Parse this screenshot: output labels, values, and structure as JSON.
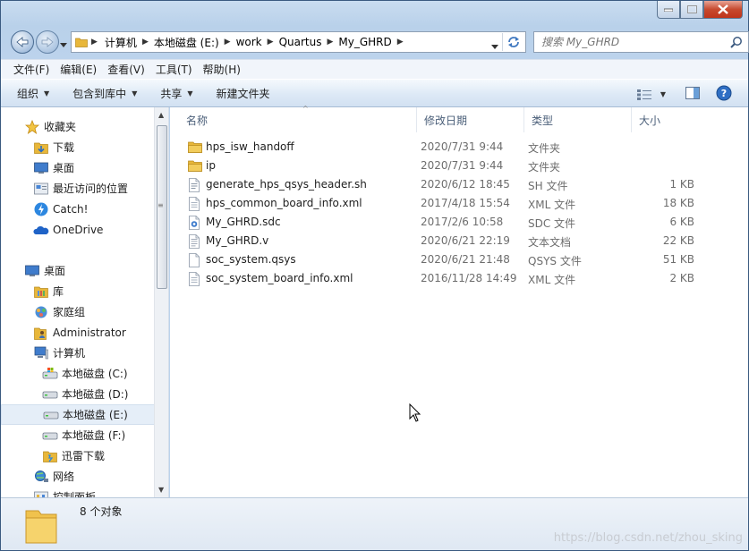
{
  "window": {
    "title_buttons": {
      "minimize": "minimize-button",
      "maximize": "maximize-button",
      "close": "close-button"
    }
  },
  "address": {
    "crumbs": [
      "计算机",
      "本地磁盘 (E:)",
      "work",
      "Quartus",
      "My_GHRD"
    ]
  },
  "search": {
    "placeholder": "搜索 My_GHRD"
  },
  "menubar": {
    "items": [
      "文件(F)",
      "编辑(E)",
      "查看(V)",
      "工具(T)",
      "帮助(H)"
    ]
  },
  "toolbar": {
    "organize": "组织",
    "include_library": "包含到库中",
    "share": "共享",
    "new_folder": "新建文件夹"
  },
  "nav": {
    "items": [
      {
        "label": "收藏夹",
        "icon": "star-icon",
        "indent": 0
      },
      {
        "label": "下载",
        "icon": "download-folder-icon",
        "indent": 1
      },
      {
        "label": "桌面",
        "icon": "desktop-icon",
        "indent": 1
      },
      {
        "label": "最近访问的位置",
        "icon": "recent-places-icon",
        "indent": 1
      },
      {
        "label": "Catch!",
        "icon": "catch-icon",
        "indent": 1
      },
      {
        "label": "OneDrive",
        "icon": "onedrive-icon",
        "indent": 1
      },
      {
        "label": "桌面",
        "icon": "desktop-icon",
        "indent": 0
      },
      {
        "label": "库",
        "icon": "library-icon",
        "indent": 1
      },
      {
        "label": "家庭组",
        "icon": "homegroup-icon",
        "indent": 1
      },
      {
        "label": "Administrator",
        "icon": "user-folder-icon",
        "indent": 1
      },
      {
        "label": "计算机",
        "icon": "computer-icon",
        "indent": 1
      },
      {
        "label": "本地磁盘 (C:)",
        "icon": "drive-c-icon",
        "indent": 2
      },
      {
        "label": "本地磁盘 (D:)",
        "icon": "drive-icon",
        "indent": 2
      },
      {
        "label": "本地磁盘 (E:)",
        "icon": "drive-icon",
        "indent": 2,
        "selected": true
      },
      {
        "label": "本地磁盘 (F:)",
        "icon": "drive-icon",
        "indent": 2
      },
      {
        "label": "迅雷下载",
        "icon": "xunlei-folder-icon",
        "indent": 2
      },
      {
        "label": "网络",
        "icon": "network-icon",
        "indent": 1
      },
      {
        "label": "控制面板",
        "icon": "control-panel-icon",
        "indent": 1
      }
    ]
  },
  "columns": {
    "name": "名称",
    "date": "修改日期",
    "type": "类型",
    "size": "大小"
  },
  "files": [
    {
      "name": "hps_isw_handoff",
      "date": "2020/7/31 9:44",
      "type": "文件夹",
      "size": "",
      "icon": "folder-icon"
    },
    {
      "name": "ip",
      "date": "2020/7/31 9:44",
      "type": "文件夹",
      "size": "",
      "icon": "folder-icon"
    },
    {
      "name": "generate_hps_qsys_header.sh",
      "date": "2020/6/12 18:45",
      "type": "SH 文件",
      "size": "1 KB",
      "icon": "script-file-icon"
    },
    {
      "name": "hps_common_board_info.xml",
      "date": "2017/4/18 15:54",
      "type": "XML 文件",
      "size": "18 KB",
      "icon": "document-file-icon"
    },
    {
      "name": "My_GHRD.sdc",
      "date": "2017/2/6 10:58",
      "type": "SDC 文件",
      "size": "6 KB",
      "icon": "sdc-file-icon"
    },
    {
      "name": "My_GHRD.v",
      "date": "2020/6/21 22:19",
      "type": "文本文档",
      "size": "22 KB",
      "icon": "text-file-icon"
    },
    {
      "name": "soc_system.qsys",
      "date": "2020/6/21 21:48",
      "type": "QSYS 文件",
      "size": "51 KB",
      "icon": "blank-file-icon"
    },
    {
      "name": "soc_system_board_info.xml",
      "date": "2016/11/28 14:49",
      "type": "XML 文件",
      "size": "2 KB",
      "icon": "document-file-icon"
    }
  ],
  "status": {
    "count": "8 个对象"
  },
  "watermark": "https://blog.csdn.net/zhou_sking",
  "colors": {
    "folder": "#e8b73a",
    "accent": "#1c5db8",
    "selection": "#e5eef8"
  }
}
